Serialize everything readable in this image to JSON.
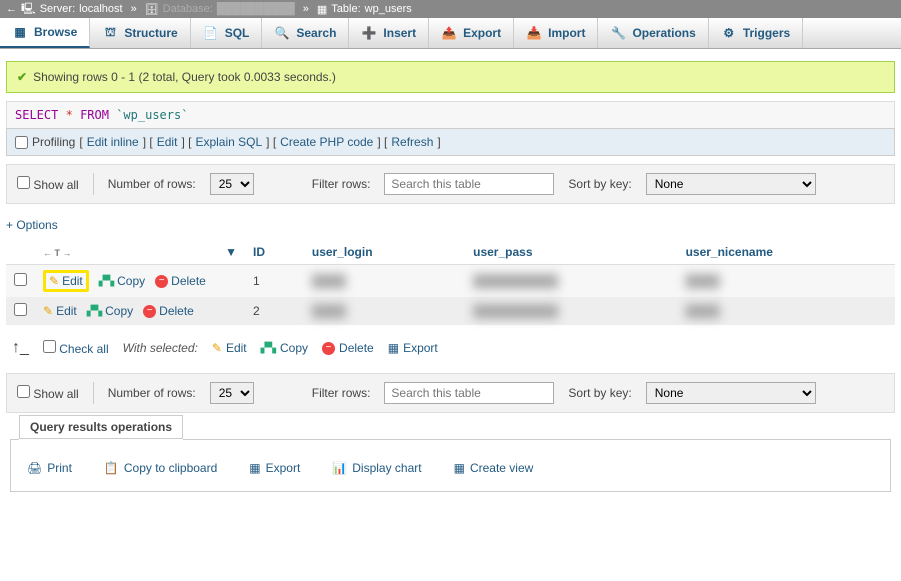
{
  "breadcrumb": {
    "server_label": "Server:",
    "server_value": "localhost",
    "database_label": "Database:",
    "database_value": "██████████",
    "table_label": "Table:",
    "table_value": "wp_users"
  },
  "tabs": {
    "browse": "Browse",
    "structure": "Structure",
    "sql": "SQL",
    "search": "Search",
    "insert": "Insert",
    "export": "Export",
    "import": "Import",
    "operations": "Operations",
    "triggers": "Triggers"
  },
  "success": {
    "message": "Showing rows 0 - 1 (2 total, Query took 0.0033 seconds.)"
  },
  "query": {
    "select": "SELECT",
    "star": "*",
    "from": "FROM",
    "table": "`wp_users`"
  },
  "query_actions": {
    "profiling": "Profiling",
    "edit_inline": "Edit inline",
    "edit": "Edit",
    "explain_sql": "Explain SQL",
    "create_php": "Create PHP code",
    "refresh": "Refresh"
  },
  "toolbar": {
    "show_all": "Show all",
    "num_rows_label": "Number of rows:",
    "num_rows_value": "25",
    "filter_label": "Filter rows:",
    "filter_placeholder": "Search this table",
    "sort_label": "Sort by key:",
    "sort_value": "None"
  },
  "options_link": "+ Options",
  "columns": {
    "id": "ID",
    "user_login": "user_login",
    "user_pass": "user_pass",
    "user_nicename": "user_nicename"
  },
  "row_actions": {
    "edit": "Edit",
    "copy": "Copy",
    "delete": "Delete"
  },
  "rows": [
    {
      "id": "1",
      "user_login": "████",
      "user_pass": "██████████",
      "user_nicename": "████"
    },
    {
      "id": "2",
      "user_login": "████",
      "user_pass": "██████████",
      "user_nicename": "████"
    }
  ],
  "bulk": {
    "check_all": "Check all",
    "with_selected": "With selected:",
    "edit": "Edit",
    "copy": "Copy",
    "delete": "Delete",
    "export": "Export"
  },
  "ops": {
    "title": "Query results operations",
    "print": "Print",
    "copy_clipboard": "Copy to clipboard",
    "export": "Export",
    "display_chart": "Display chart",
    "create_view": "Create view"
  }
}
